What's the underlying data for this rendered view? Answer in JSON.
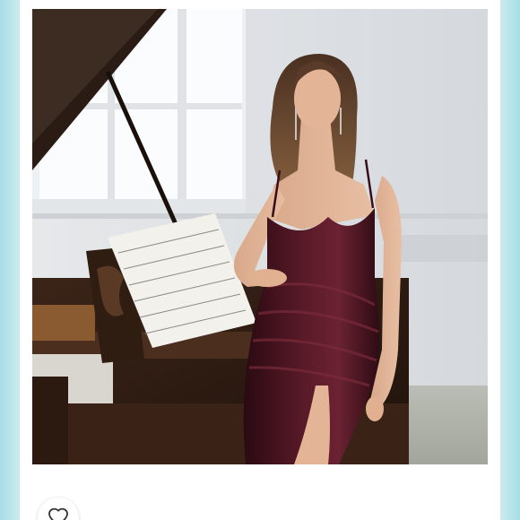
{
  "listing": {
    "image_subject": "woman-in-burgundy-velvet-dress-photo",
    "like_icon": "heart-outline-icon"
  },
  "colors": {
    "page_edge_tint": "#a8dde6",
    "card_background": "#ffffff",
    "dress_burgundy": "#4a1420"
  }
}
